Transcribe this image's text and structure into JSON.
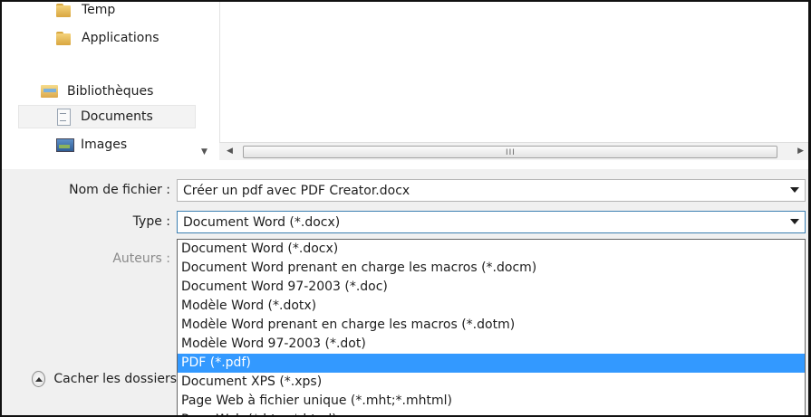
{
  "navigation": {
    "items": [
      {
        "label": "Temp",
        "icon": "folder-icon"
      },
      {
        "label": "Applications",
        "icon": "folder-icon"
      },
      {
        "label": "Bibliothèques",
        "icon": "library-icon"
      },
      {
        "label": "Documents",
        "icon": "documents-icon"
      },
      {
        "label": "Images",
        "icon": "images-icon"
      }
    ],
    "selected": "Documents"
  },
  "file_list": {
    "scroll_grip": "III"
  },
  "form": {
    "filename_label": "Nom de fichier :",
    "filename_value": "Créer un pdf avec PDF Creator.docx",
    "type_label": "Type :",
    "type_value": "Document Word (*.docx)",
    "authors_label": "Auteurs :"
  },
  "type_options": [
    "Document Word (*.docx)",
    "Document Word prenant en charge les macros (*.docm)",
    "Document Word 97-2003 (*.doc)",
    "Modèle Word (*.dotx)",
    "Modèle Word prenant en charge les macros (*.dotm)",
    "Modèle Word 97-2003 (*.dot)",
    "PDF (*.pdf)",
    "Document XPS (*.xps)",
    "Page Web à fichier unique (*.mht;*.mhtml)",
    "Page Web (*.htm;*.html)"
  ],
  "highlighted_option": "PDF (*.pdf)",
  "footer": {
    "hide_folders_label": "Cacher les dossiers"
  },
  "colors": {
    "highlight": "#3399ff",
    "focus_border": "#3c7fb1"
  }
}
